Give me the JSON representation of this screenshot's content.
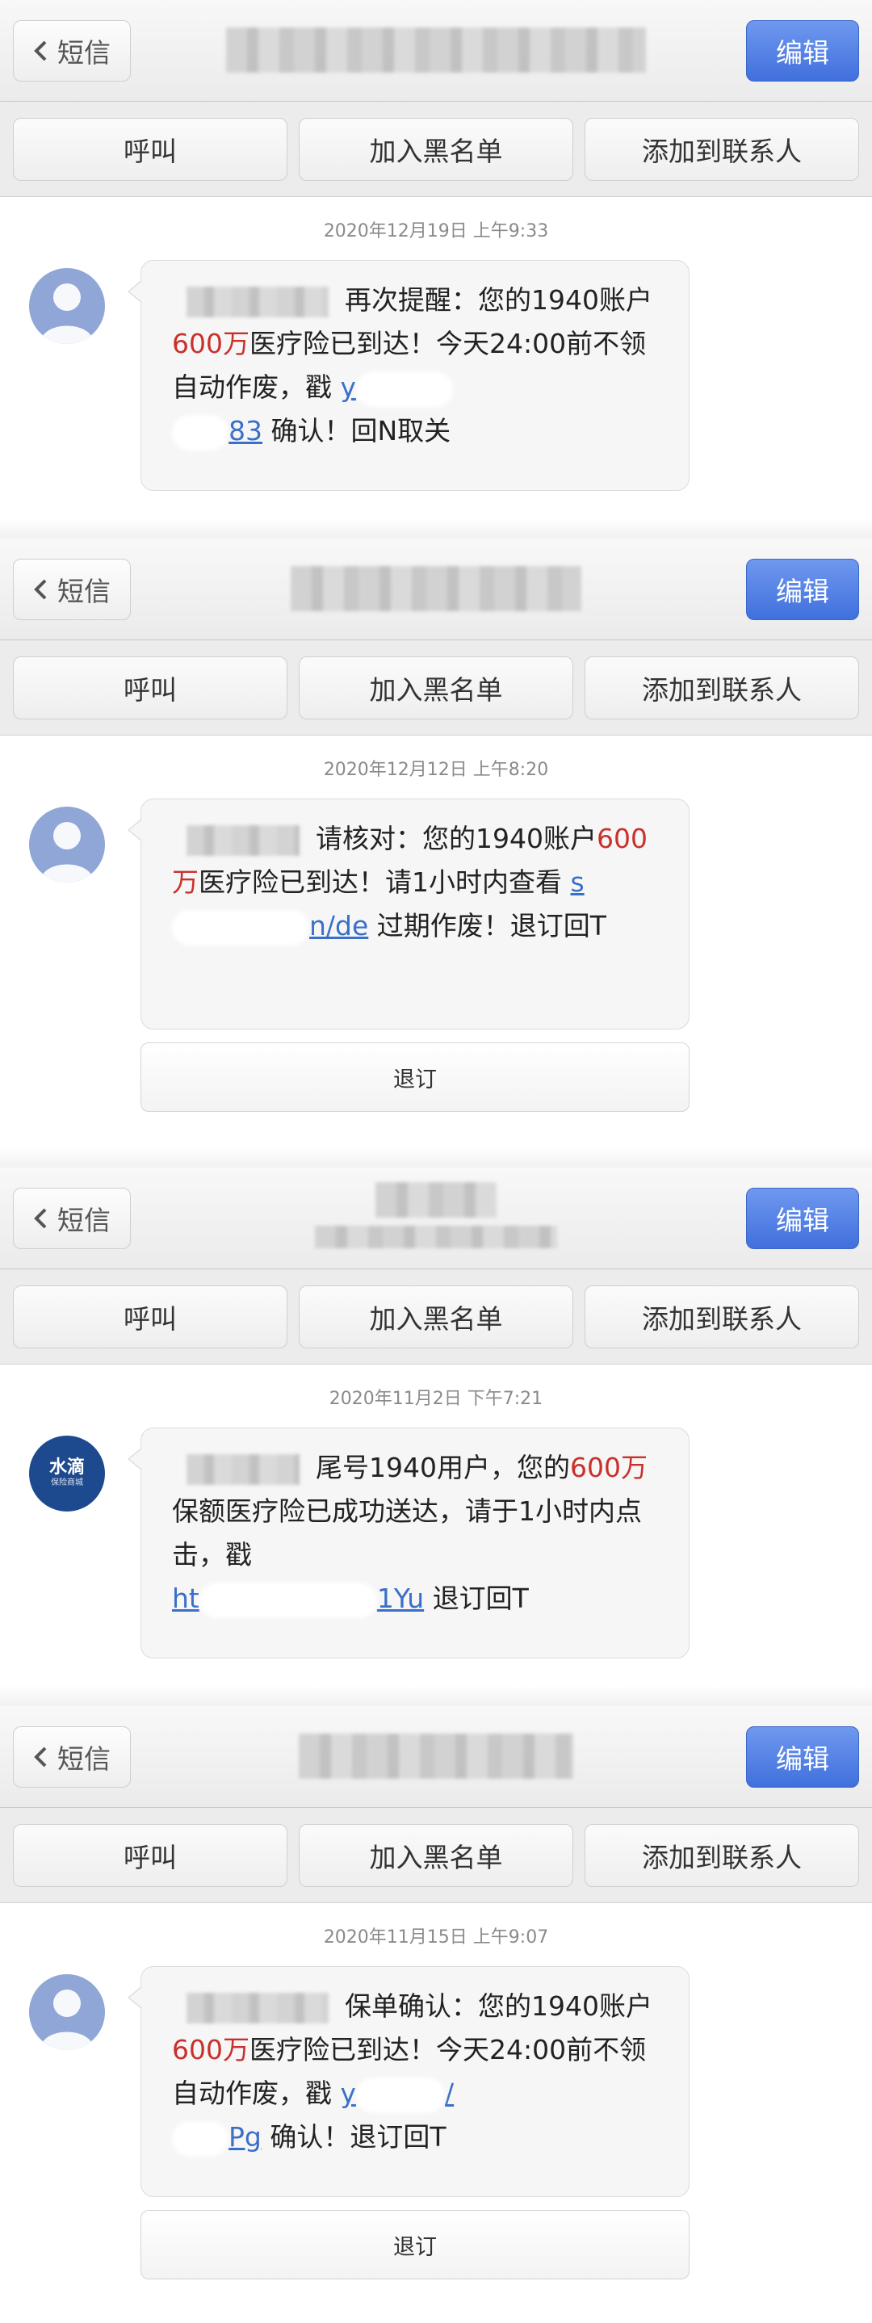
{
  "nav": {
    "back_label": "短信",
    "edit_label": "编辑"
  },
  "actions": {
    "call": "呼叫",
    "blacklist": "加入黑名单",
    "add_contact": "添加到联系人"
  },
  "conversations": [
    {
      "timestamp": "2020年12月19日 上午9:33",
      "text_a": "再次提醒：您的1940账户",
      "amount": "600万",
      "text_b": "医疗险已到达！今天24:00前不领自动作废，戳 ",
      "link_a": "y",
      "link_b": "83",
      "text_c": " 确认！回N取关"
    },
    {
      "timestamp": "2020年12月12日 上午8:20",
      "text_a": "请核对：您的1940账户",
      "amount": "600万",
      "text_b": "医疗险已到达！请1小时内查看 ",
      "link_a": "s",
      "link_b": "n/de",
      "text_c": " 过期作废！退订回T",
      "unsubscribe": "退订"
    },
    {
      "timestamp": "2020年11月2日 下午7:21",
      "avatar_brand": "水滴",
      "avatar_sub": "保险商城",
      "text_a": "尾号1940用户，您的",
      "amount": "600万",
      "text_b": "保额医疗险已成功送达，请于1小时内点击，戳 ",
      "link_a": "ht",
      "link_b": "1Yu",
      "text_c": " 退订回T"
    },
    {
      "timestamp": "2020年11月15日 上午9:07",
      "text_a": "保单确认：您的1940账户",
      "amount": "600万",
      "text_b": "医疗险已到达！今天24:00前不领自动作废，戳 ",
      "link_a": "y",
      "link_b": "/",
      "link_c": "Pg",
      "text_c": " 确认！退订回T",
      "unsubscribe": "退订"
    }
  ],
  "colors": {
    "edit_button": "#4a78e0",
    "amount": "#c9302c",
    "link": "#3a6fc9"
  }
}
